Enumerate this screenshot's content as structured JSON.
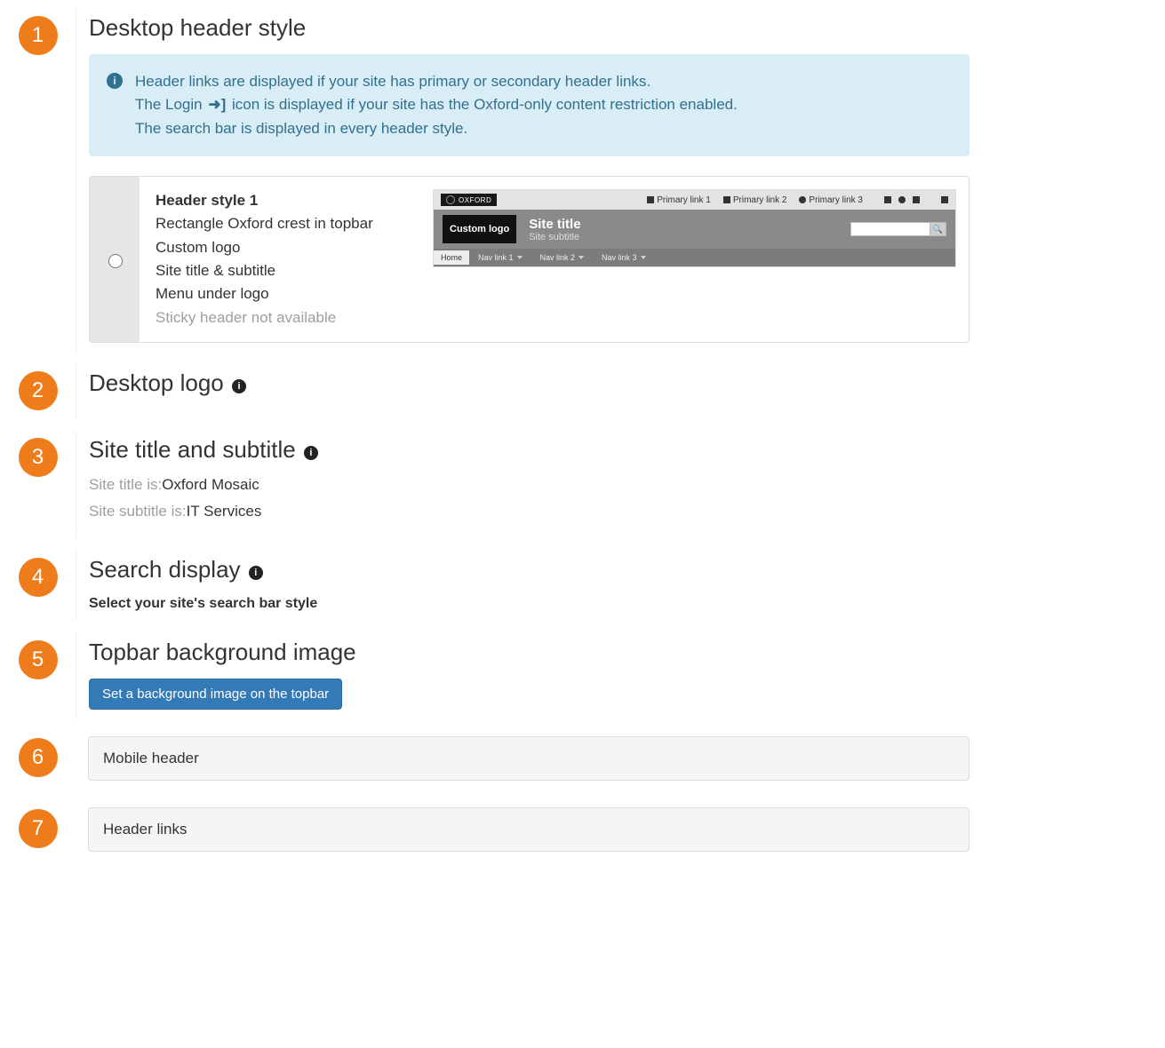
{
  "sections": {
    "s1": {
      "num": "1",
      "title": "Desktop header style"
    },
    "s2": {
      "num": "2",
      "title": "Desktop logo"
    },
    "s3": {
      "num": "3",
      "title": "Site title and subtitle"
    },
    "s4": {
      "num": "4",
      "title": "Search display"
    },
    "s5": {
      "num": "5",
      "title": "Topbar background image"
    },
    "s6": {
      "num": "6",
      "title": "Mobile header"
    },
    "s7": {
      "num": "7",
      "title": "Header links"
    }
  },
  "alert": {
    "line1a": "Header links are displayed if your site has primary or secondary header links.",
    "line2a": "The Login ",
    "line2b": " icon is displayed if your site has the Oxford-only content restriction enabled.",
    "line3": "The search bar is displayed in every header style."
  },
  "option1": {
    "title": "Header style 1",
    "l1": "Rectangle Oxford crest in topbar",
    "l2": "Custom logo",
    "l3": "Site title & subtitle",
    "l4": "Menu under logo",
    "l5": "Sticky header not available"
  },
  "preview": {
    "oxford": "OXFORD",
    "primary1": "Primary link 1",
    "primary2": "Primary link 2",
    "primary3": "Primary link 3",
    "custom_logo": "Custom logo",
    "site_title": "Site title",
    "site_subtitle": "Site subtitle",
    "home": "Home",
    "nav1": "Nav link 1",
    "nav2": "Nav link 2",
    "nav3": "Nav link 3",
    "search_glyph": "🔍"
  },
  "site_info": {
    "title_label": "Site title is:",
    "title_value": "Oxford Mosaic",
    "subtitle_label": "Site subtitle is:",
    "subtitle_value": "IT Services"
  },
  "search_section": {
    "help": "Select your site's search bar style"
  },
  "topbar_bg": {
    "button": "Set a background image on the topbar"
  }
}
